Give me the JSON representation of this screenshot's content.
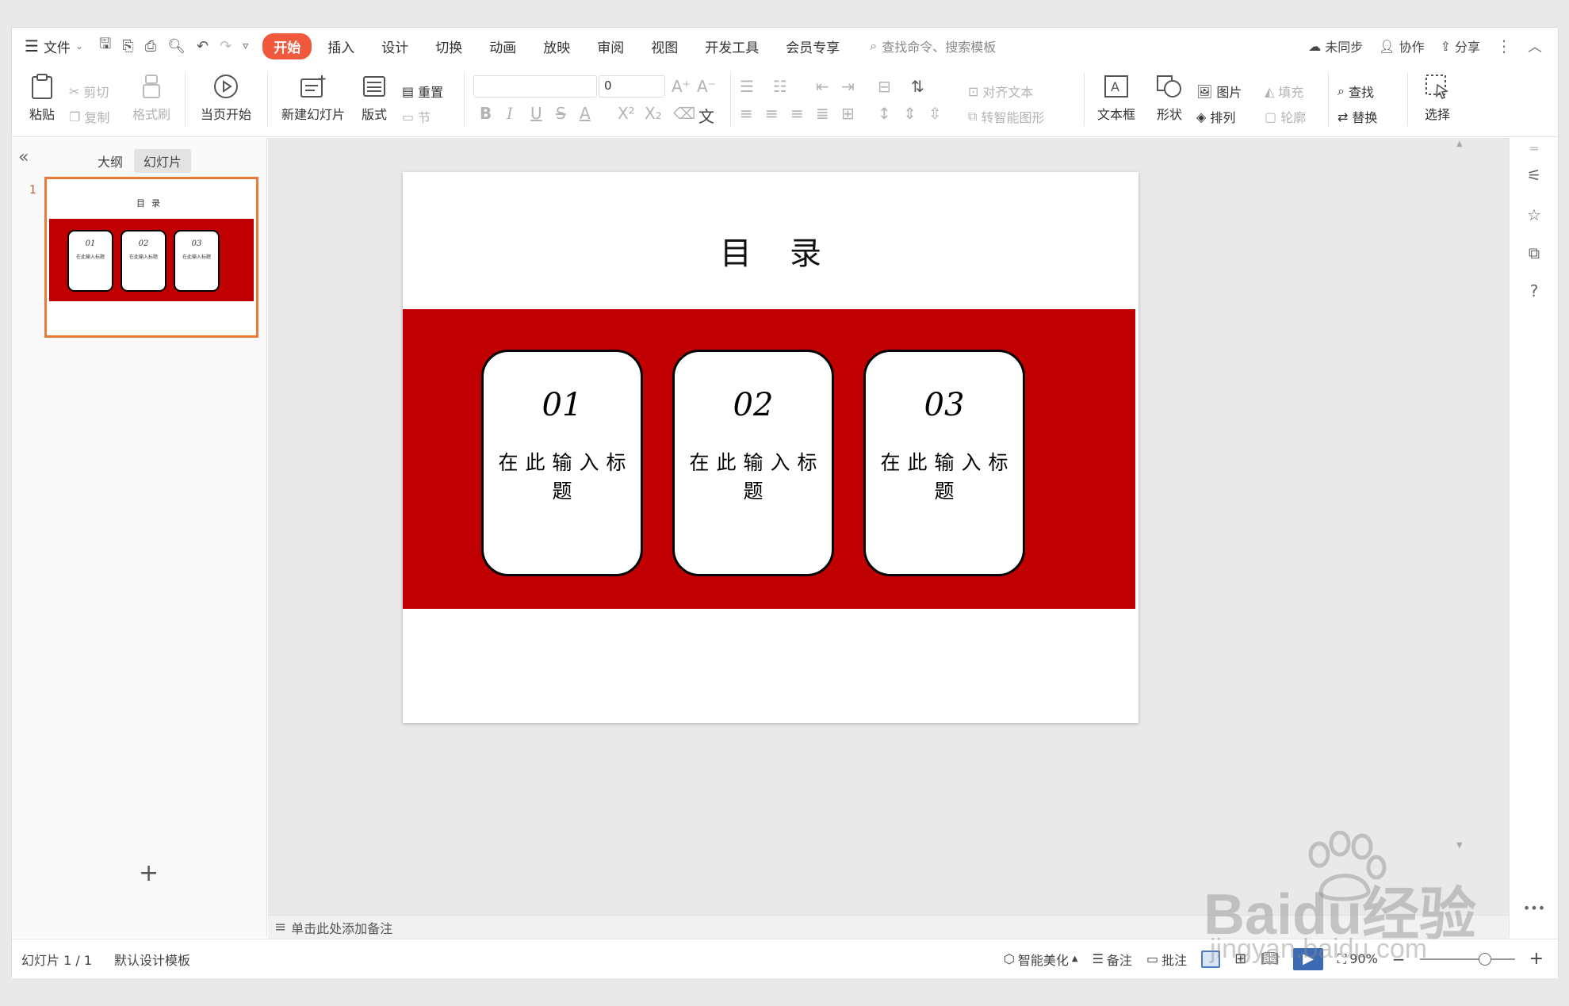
{
  "menubar": {
    "file_label": "文件",
    "tabs": [
      {
        "label": "开始",
        "active": true
      },
      {
        "label": "插入",
        "active": false
      },
      {
        "label": "设计",
        "active": false
      },
      {
        "label": "切换",
        "active": false
      },
      {
        "label": "动画",
        "active": false
      },
      {
        "label": "放映",
        "active": false
      },
      {
        "label": "审阅",
        "active": false
      },
      {
        "label": "视图",
        "active": false
      },
      {
        "label": "开发工具",
        "active": false
      },
      {
        "label": "会员专享",
        "active": false
      }
    ],
    "search_placeholder": "查找命令、搜索模板",
    "right": {
      "sync": "未同步",
      "collab": "协作",
      "share": "分享"
    }
  },
  "ribbon": {
    "paste": "粘贴",
    "cut": "剪切",
    "copy": "复制",
    "format_painter": "格式刷",
    "play_from_current": "当页开始",
    "new_slide": "新建幻灯片",
    "layout": "版式",
    "reset": "重置",
    "section": "节",
    "font_size": "0",
    "align_text": "对齐文本",
    "smartart": "转智能图形",
    "textbox": "文本框",
    "shape": "形状",
    "picture": "图片",
    "arrange": "排列",
    "fill": "填充",
    "outline": "轮廓",
    "find": "查找",
    "replace": "替换",
    "select": "选择"
  },
  "leftpane": {
    "tab_outline": "大纲",
    "tab_slides": "幻灯片",
    "slide_number": "1"
  },
  "slide": {
    "title": "目录",
    "cards": [
      {
        "number": "01",
        "subtitle": "在此输入标题"
      },
      {
        "number": "02",
        "subtitle": "在此输入标题"
      },
      {
        "number": "03",
        "subtitle": "在此输入标题"
      }
    ],
    "band_color": "#c00000"
  },
  "notes": {
    "placeholder": "单击此处添加备注"
  },
  "statusbar": {
    "slide_counter": "幻灯片 1 / 1",
    "template": "默认设计模板",
    "beautify": "智能美化",
    "notes": "备注",
    "comment": "批注",
    "zoom": "90%"
  },
  "watermark": {
    "brand": "Baidu经验",
    "url": "jingyan.baidu.com"
  },
  "colors": {
    "accent": "#f0593b",
    "thumb_border": "#e97a38"
  }
}
